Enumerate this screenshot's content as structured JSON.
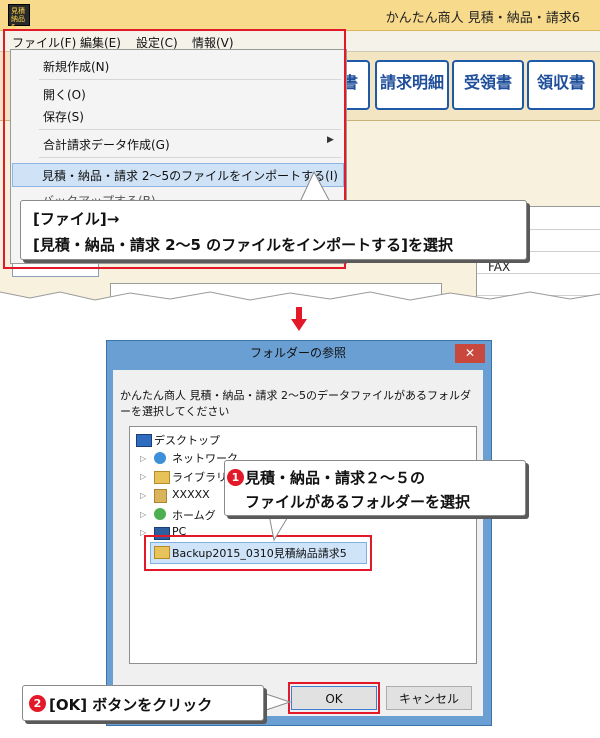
{
  "app": {
    "title": "かんたん商人 見積・納品・請求6",
    "icon_text": "見積 納品 6",
    "menu": [
      "ファイル(F)",
      "編集(E)",
      "設定(C)",
      "情報(V)"
    ],
    "toolbar_buttons": [
      "書",
      "請求明細",
      "受領書",
      "領収書"
    ],
    "fax_label": "FAX",
    "dropdown": {
      "new": "新規作成(N)",
      "open": "開く(O)",
      "save": "保存(S)",
      "summary": "合計請求データ作成(G)",
      "import": "見積・納品・請求 2～5のファイルをインポートする(I)",
      "backup": "バックアップする(B)"
    }
  },
  "callout1": {
    "line1": "[ファイル]→",
    "line2": "[見積・納品・請求 2～5 のファイルをインポートする]を選択"
  },
  "dialog": {
    "title": "フォルダーの参照",
    "close_glyph": "✕",
    "description": "かんたん商人 見積・納品・請求 2～5のデータファイルがあるフォルダーを選択してください",
    "tree": {
      "desktop": "デスクトップ",
      "network": "ネットワーク",
      "library": "ライブラリ",
      "user": "XXXXX",
      "homegroup": "ホームグ",
      "pc": "PC",
      "selected": "Backup2015_0310見積納品請求5"
    },
    "ok_label": "OK",
    "cancel_label": "キャンセル"
  },
  "callout2": {
    "num": "1",
    "line1": "見積・納品・請求２～５の",
    "line2": "ファイルがあるフォルダーを選択"
  },
  "callout3": {
    "num": "2",
    "text": "[OK] ボタンをクリック"
  },
  "colors": {
    "accent_red": "#e3192a",
    "dialog_frame": "#6a9fd3",
    "toolbar_blue": "#1f5aa8"
  }
}
